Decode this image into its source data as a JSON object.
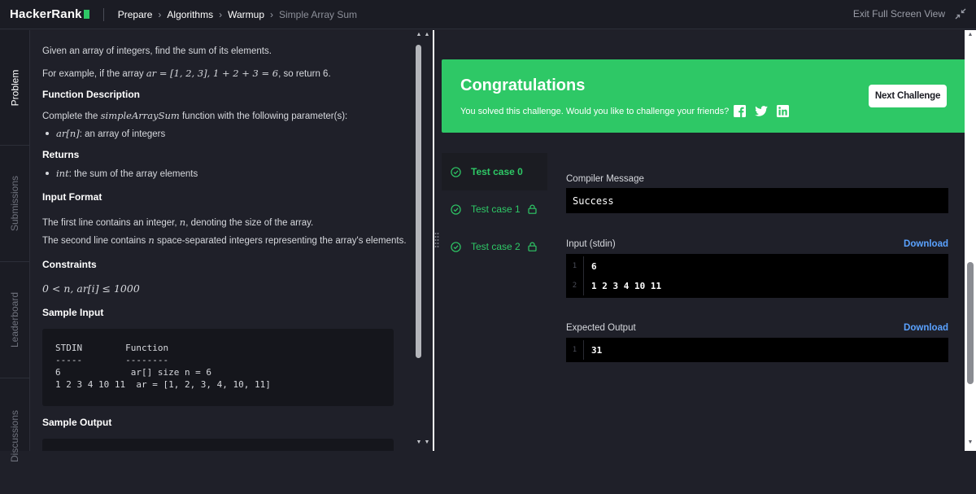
{
  "topbar": {
    "logo": "HackerRank",
    "breadcrumbs": [
      "Prepare",
      "Algorithms",
      "Warmup"
    ],
    "current": "Simple Array Sum",
    "exit_label": "Exit Full Screen View"
  },
  "side_tabs": [
    "Problem",
    "Submissions",
    "Leaderboard",
    "Discussions"
  ],
  "problem": {
    "intro": "Given an array of integers, find the sum of its elements.",
    "example_prefix": "For example, if the array ",
    "example_math": "ar = [1, 2, 3], 1 + 2 + 3 = 6",
    "example_suffix": ", so return 6.",
    "h_function": "Function Description",
    "fd_prefix": "Complete the ",
    "fd_math": "simpleArraySum",
    "fd_suffix": " function with the following parameter(s):",
    "param_math": "ar[n]",
    "param_text": ": an array of integers",
    "h_returns": "Returns",
    "ret_math": "int",
    "ret_text": ": the sum of the array elements",
    "h_input": "Input Format",
    "in1_prefix": "The first line contains an integer, ",
    "in1_math": "n",
    "in1_suffix": ", denoting the size of the array.",
    "in2_prefix": "The second line contains ",
    "in2_math": "n",
    "in2_suffix": " space-separated integers representing the array's elements.",
    "h_constraints": "Constraints",
    "constraint_math": "0 < n, ar[i] ≤ 1000",
    "h_sample_input": "Sample Input",
    "sample_input": "STDIN        Function\n-----        --------\n6             ar[] size n = 6\n1 2 3 4 10 11  ar = [1, 2, 3, 4, 10, 11]",
    "h_sample_output": "Sample Output"
  },
  "result": {
    "title": "Congratulations",
    "subtitle": "You solved this challenge. Would you like to challenge your friends?",
    "next_button": "Next Challenge",
    "accent": "#2ec866"
  },
  "test_cases": [
    {
      "label": "Test case 0",
      "locked": false
    },
    {
      "label": "Test case 1",
      "locked": true
    },
    {
      "label": "Test case 2",
      "locked": true
    }
  ],
  "output": {
    "compiler_label": "Compiler Message",
    "compiler_message": "Success",
    "input_label": "Input (stdin)",
    "download": "Download",
    "input_lines": [
      {
        "n": "1",
        "v": "6"
      },
      {
        "n": "2",
        "v": "1 2 3 4 10 11"
      }
    ],
    "expected_label": "Expected Output",
    "expected_lines": [
      {
        "n": "1",
        "v": "31"
      }
    ]
  }
}
